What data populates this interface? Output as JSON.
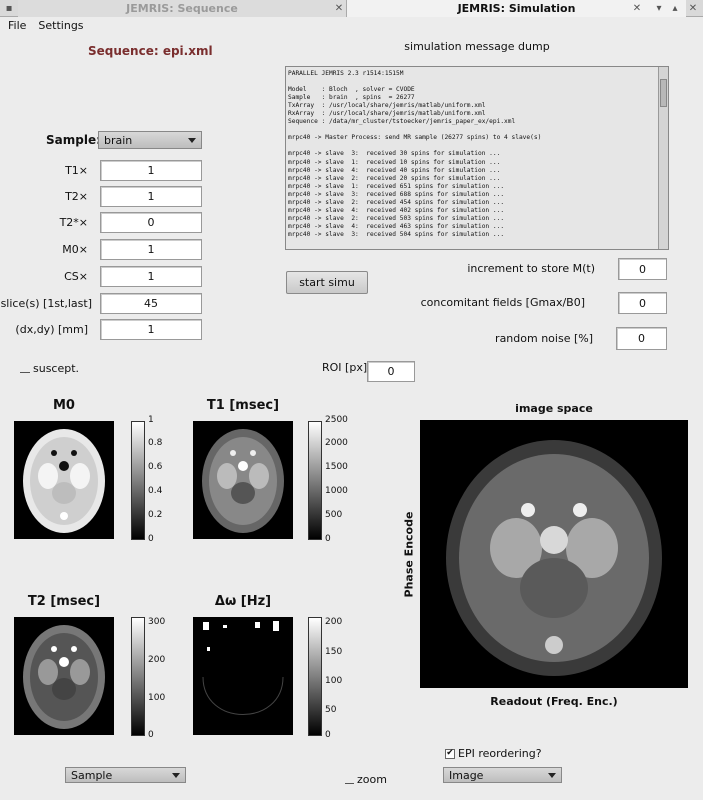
{
  "window": {
    "tab_inactive": "JEMRIS: Sequence",
    "tab_active": "JEMRIS: Simulation"
  },
  "menu": {
    "items": [
      "File",
      "Settings"
    ]
  },
  "sequence_label": "Sequence: epi.xml",
  "sample": {
    "label": "Sample:",
    "value": "brain",
    "params": [
      {
        "label": "T1×",
        "value": "1"
      },
      {
        "label": "T2×",
        "value": "1"
      },
      {
        "label": "T2*×",
        "value": "0"
      },
      {
        "label": "M0×",
        "value": "1"
      },
      {
        "label": "CS×",
        "value": "1"
      },
      {
        "label": "slice(s) [1st,last]",
        "value": "45"
      },
      {
        "label": "(dx,dy) [mm]",
        "value": "1"
      }
    ],
    "suscept_label": "suscept."
  },
  "dump": {
    "title": "simulation message dump",
    "lines": [
      "PARALLEL JEMRIS 2.3 r1514:1515M",
      "",
      "Model    : Bloch  , solver = CVODE",
      "Sample   : brain  , spins  = 26277",
      "TxArray  : /usr/local/share/jemris/matlab/uniform.xml",
      "RxArray  : /usr/local/share/jemris/matlab/uniform.xml",
      "Sequence : /data/mr_cluster/tstoecker/jemris_paper_ex/epi.xml",
      "",
      "mrpc40 -> Master Process: send MR sample (26277 spins) to 4 slave(s)",
      "",
      "mrpc40 -> slave  3:  received 30 spins for simulation ...",
      "mrpc40 -> slave  1:  received 10 spins for simulation ...",
      "mrpc40 -> slave  4:  received 40 spins for simulation ...",
      "mrpc40 -> slave  2:  received 20 spins for simulation ...",
      "mrpc40 -> slave  1:  received 651 spins for simulation ...",
      "mrpc40 -> slave  3:  received 688 spins for simulation ...",
      "mrpc40 -> slave  2:  received 454 spins for simulation ...",
      "mrpc40 -> slave  4:  received 402 spins for simulation ...",
      "mrpc40 -> slave  2:  received 503 spins for simulation ...",
      "mrpc40 -> slave  4:  received 463 spins for simulation ...",
      "mrpc40 -> slave  3:  received 504 spins for simulation ..."
    ]
  },
  "start_button": "start simu",
  "increment": {
    "label": "increment to store M(t)",
    "value": "0"
  },
  "concomitant": {
    "label": "concomitant fields [Gmax/B0]",
    "value": "0"
  },
  "noise": {
    "label": "random noise [%]",
    "value": "0"
  },
  "roi": {
    "label": "ROI [px]",
    "value": "0"
  },
  "plots": {
    "m0": {
      "title": "M0",
      "ticks": [
        "1",
        "0.8",
        "0.6",
        "0.4",
        "0.2",
        "0"
      ]
    },
    "t1": {
      "title": "T1 [msec]",
      "ticks": [
        "2500",
        "2000",
        "1500",
        "1000",
        "500",
        "0"
      ]
    },
    "t2": {
      "title": "T2 [msec]",
      "ticks": [
        "300",
        "200",
        "100",
        "0"
      ]
    },
    "dw": {
      "title": "Δω [Hz]",
      "ticks": [
        "200",
        "150",
        "100",
        "50",
        "0"
      ]
    }
  },
  "image_space": {
    "title": "image space",
    "ylabel": "Phase Encode",
    "xlabel": "Readout (Freq. Enc.)"
  },
  "epi_reordering": {
    "label": "EPI reordering?",
    "checked": true
  },
  "bottom": {
    "left_dropdown": "Sample",
    "zoom_label": "zoom",
    "right_dropdown": "Image"
  }
}
